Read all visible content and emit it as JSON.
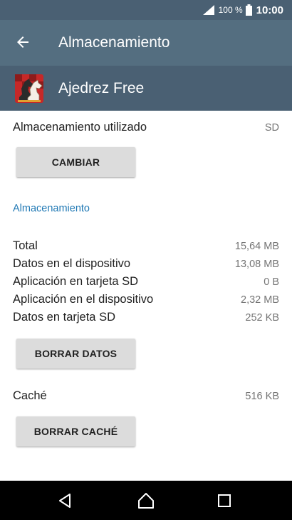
{
  "status_bar": {
    "battery_percent": "100 %",
    "time": "10:00",
    "icons": [
      "signal-icon",
      "battery-icon"
    ]
  },
  "app_bar": {
    "title": "Almacenamiento",
    "back_icon": "arrow-left-icon"
  },
  "app_header": {
    "app_name": "Ajedrez Free",
    "app_icon": "chess-knight-icon"
  },
  "storage_used": {
    "label": "Almacenamiento utilizado",
    "value": "SD",
    "change_button": "CAMBIAR"
  },
  "storage_section": {
    "header": "Almacenamiento",
    "rows": [
      {
        "label": "Total",
        "value": "15,64 MB"
      },
      {
        "label": "Datos en el dispositivo",
        "value": "13,08 MB"
      },
      {
        "label": "Aplicación en tarjeta SD",
        "value": "0 B"
      },
      {
        "label": "Aplicación en el dispositivo",
        "value": "2,32 MB"
      },
      {
        "label": "Datos en tarjeta SD",
        "value": "252 KB"
      }
    ],
    "clear_data_button": "BORRAR DATOS"
  },
  "cache": {
    "label": "Caché",
    "value": "516 KB",
    "clear_cache_button": "BORRAR CACHÉ"
  },
  "nav_bar": {
    "icons": [
      "back-triangle-icon",
      "home-icon",
      "recents-icon"
    ]
  },
  "colors": {
    "status_bar": "#4a6073",
    "app_bar": "#546e80",
    "section_accent": "#1f78b4",
    "button_bg": "#dcdcdc"
  }
}
